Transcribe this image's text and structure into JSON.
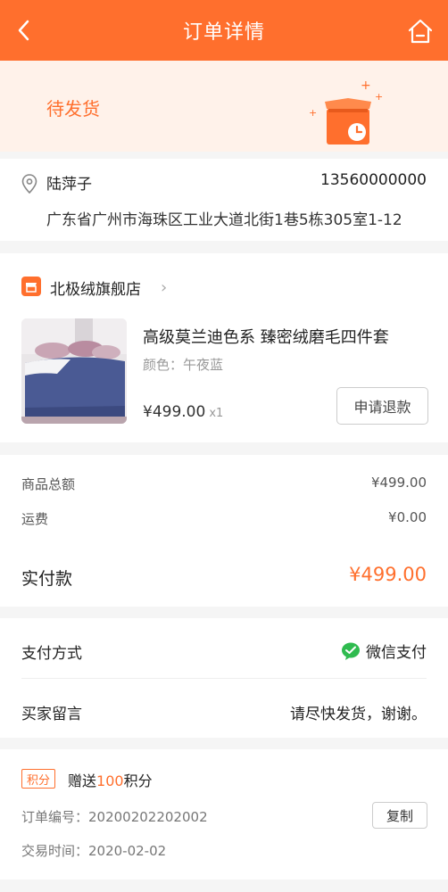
{
  "header": {
    "title": "订单详情",
    "back_icon": "chevron-left-icon",
    "home_icon": "home-icon"
  },
  "status": {
    "text": "待发货",
    "icon": "package-clock-icon"
  },
  "address": {
    "name": "陆萍子",
    "phone": "13560000000",
    "detail": "广东省广州市海珠区工业大道北街1巷5栋305室1-12"
  },
  "shop": {
    "name": "北极绒旗舰店",
    "chevron": "›",
    "product": {
      "name": "高级莫兰迪色系 臻密绒磨毛四件套",
      "color": "颜色：午夜蓝",
      "price": "¥499.00",
      "qty": "x1"
    },
    "refund_label": "申请退款"
  },
  "amounts": {
    "goods_total_label": "商品总额",
    "goods_total_value": "¥499.00",
    "shipping_label": "运费",
    "shipping_value": "¥0.00",
    "paid_label": "实付款",
    "paid_value": "¥499.00"
  },
  "payment": {
    "method_label": "支付方式",
    "method_value": "微信支付",
    "message_label": "买家留言",
    "message_value": "请尽快发货，谢谢。"
  },
  "extra": {
    "points_badge": "积分",
    "points_prefix": "赠送",
    "points_amount": "100",
    "points_suffix": "积分",
    "order_no": "订单编号：20200202202002",
    "copy_label": "复制",
    "trade_time": "交易时间：2020-02-02"
  },
  "colors": {
    "accent": "#ff6f2d",
    "status_bg": "#fff2ea",
    "wechat": "#2fbb4f"
  }
}
